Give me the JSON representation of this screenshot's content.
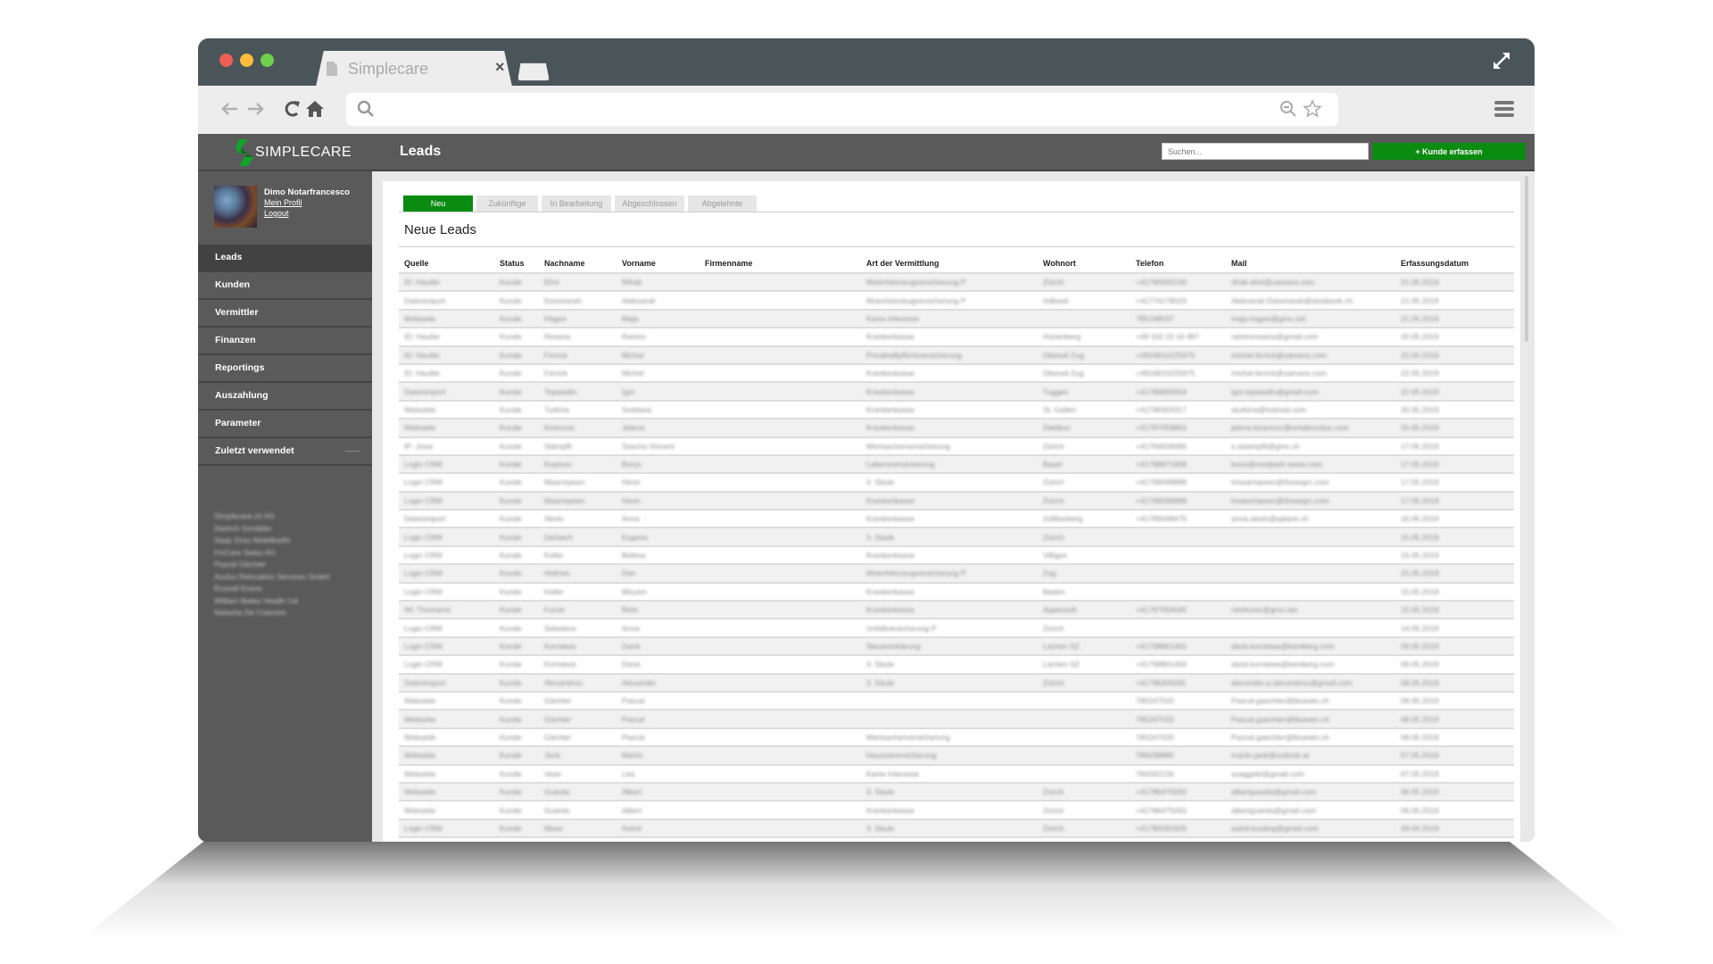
{
  "browser": {
    "tab_title": "Simplecare",
    "tab_close": "×",
    "icons": [
      "back-arrow-icon",
      "forward-arrow-icon",
      "reload-icon",
      "home-icon",
      "search-icon",
      "zoom-out-icon",
      "star-icon",
      "menu-icon",
      "expand-icon",
      "document-icon"
    ]
  },
  "app": {
    "logo_text": "SIMPLECARE",
    "page_title": "Leads",
    "search_placeholder": "Suchen...",
    "add_button": "+  Kunde erfassen",
    "brand_color": "#0b8c10"
  },
  "profile": {
    "name": "Dimo Notarfrancesco",
    "profile_link": "Mein Profil",
    "logout_link": "Logout"
  },
  "sidebar": {
    "items": [
      {
        "label": "Leads",
        "active": true
      },
      {
        "label": "Kunden"
      },
      {
        "label": "Vermittler"
      },
      {
        "label": "Finanzen"
      },
      {
        "label": "Reportings"
      },
      {
        "label": "Auszahlung"
      },
      {
        "label": "Parameter"
      },
      {
        "label": "Zuletzt verwendet",
        "collapsible": true
      }
    ],
    "recent": [
      "Simplecare.ch AG",
      "Dietrich Schöbler",
      "Sepp Zirey Abdelkadhi",
      "FinCare Swiss AG",
      "Pascal Gächter",
      "Avolux Relocation Services GmbH",
      "Russell Evans",
      "William Bailey Health Ltd",
      "Natasha De Coteclos"
    ]
  },
  "main": {
    "tabs": [
      {
        "label": "Neu",
        "active": true
      },
      {
        "label": "Zukünftige"
      },
      {
        "label": "In Bearbeitung"
      },
      {
        "label": "Abgeschlossen"
      },
      {
        "label": "Abgelehnte"
      }
    ],
    "section_title": "Neue Leads",
    "columns": [
      "Quelle",
      "Status",
      "Nachname",
      "Vorname",
      "Firmenname",
      "Art der Vermittlung",
      "Wohnort",
      "Telefon",
      "Mail",
      "Erfassungsdatum"
    ],
    "rows": [
      [
        "ID: Hautlei",
        "Kunde",
        "Elmi",
        "Rihab",
        "",
        "Motorfahrzeugversicherung P",
        "Zürich",
        "+41780000140",
        "rihab.elmi@xamans.com",
        "21.05.2019"
      ],
      [
        "Datenimport",
        "Kunde",
        "Dotomarah",
        "Aleksandr",
        "",
        "Motorfahrzeugversicherung P",
        "Adliswil",
        "+41774178020",
        "Aleksandr.Dotomarah@dastbank.ch",
        "21.05.2019"
      ],
      [
        "Webseite",
        "Kunde",
        "Hagen",
        "Maja",
        "",
        "Keine Interesse",
        "",
        "785198037",
        "maja.hagen@gmx.net",
        "21.05.2019"
      ],
      [
        "ID: Hautlei",
        "Kunde",
        "Resana",
        "Ramiro",
        "",
        "Krankenkasse",
        "Hünenberg",
        "+49 163 23 16 497",
        "ramiroresana@gmail.com",
        "20.05.2019"
      ],
      [
        "ID: Hautlei",
        "Kunde",
        "Ferrick",
        "Michel",
        "",
        "Privathaftpflichtversicherung",
        "Oberwil Zug",
        "+4916810225975",
        "michel.ferrick@xamans.com",
        "22.05.2019"
      ],
      [
        "ID: Hautlei",
        "Kunde",
        "Ferrick",
        "Michel",
        "",
        "Krankenkasse",
        "Oberwil Zug",
        "+4916810225975",
        "michel.ferrick@xamans.com",
        "22.05.2019"
      ],
      [
        "Datenimport",
        "Kunde",
        "Topaladin",
        "Igor",
        "",
        "Krankenkasse",
        "Tuggen",
        "+41786800554",
        "igor.topaladin@gmail.com",
        "22.05.2019"
      ],
      [
        "Webseite",
        "Kunde",
        "Turkina",
        "Svetlana",
        "",
        "Krankenkasse",
        "St. Gallen",
        "+41786303317",
        "sturkina@hotmail.com",
        "20.05.2019"
      ],
      [
        "Webseite",
        "Kunde",
        "Kiranovic",
        "Jelena",
        "",
        "Krankenkasse",
        "Dietikon",
        "+41787059863",
        "jelena.kiranovic@emidexodus.com",
        "20.05.2019"
      ],
      [
        "IP: Jossi",
        "Kunde",
        "Stämpfli",
        "Sascha Vincent",
        "",
        "Wertsachenversicherung",
        "Zürich",
        "+41794634086",
        "s.staempfli@gmx.ch",
        "17.05.2019"
      ],
      [
        "Login CRM",
        "Kunde",
        "Kuptsov",
        "Borys",
        "",
        "Lebensversicherung",
        "Basel",
        "+41788871808",
        "boris@medpark-swiss.com",
        "17.05.2019"
      ],
      [
        "Login CRM",
        "Kunde",
        "Maarmpeen",
        "Henri",
        "",
        "3. Säule",
        "Zürich",
        "+41799008888",
        "hmaarmpeen@thosegrc.com",
        "17.05.2019"
      ],
      [
        "Login CRM",
        "Kunde",
        "Maarmpeen",
        "Henri",
        "",
        "Krankenkasse",
        "Zürich",
        "+41799008888",
        "hmaarmpeen@thosegrc.com",
        "17.05.2019"
      ],
      [
        "Datenimport",
        "Kunde",
        "Abolo",
        "Anna",
        "",
        "Krankenkasse",
        "Zollikerberg",
        "+41789008475",
        "anna.abolo@splank.ch",
        "16.05.2019"
      ],
      [
        "Login CRM",
        "Kunde",
        "Derbach",
        "Eugene",
        "",
        "3. Säule",
        "Zürich",
        "",
        "",
        "15.05.2019"
      ],
      [
        "Login CRM",
        "Kunde",
        "Keller",
        "Bettina",
        "",
        "Krankenkasse",
        "Villigen",
        "",
        "",
        "15.05.2019"
      ],
      [
        "Login CRM",
        "Kunde",
        "Holmes",
        "Dan",
        "",
        "Motorfahrzeugversicherung P",
        "Zug",
        "",
        "",
        "15.05.2019"
      ],
      [
        "Login CRM",
        "Kunde",
        "Keller",
        "Miryam",
        "",
        "Krankenkasse",
        "Baden",
        "",
        "",
        "15.05.2019"
      ],
      [
        "IM: Thomanni",
        "Kunde",
        "Furrer",
        "Reto",
        "",
        "Krankenkasse",
        "Appenzell",
        "+41787054045",
        "retofurrer@gmx.net",
        "15.05.2019"
      ],
      [
        "Login CRM",
        "Kunde",
        "Sebekina",
        "Anna",
        "",
        "Unfallversicherung P",
        "Zürich",
        "",
        "",
        "14.05.2019"
      ],
      [
        "Login CRM",
        "Kunde",
        "Korniewa",
        "Daria",
        "",
        "Steuererklärung",
        "Lachen SZ",
        "+41798801450",
        "daria.korniewa@kantberg.com",
        "09.05.2019"
      ],
      [
        "Login CRM",
        "Kunde",
        "Korniewa",
        "Daria",
        "",
        "3. Säule",
        "Lachen SZ",
        "+41798801450",
        "daria.korniewa@kantberg.com",
        "09.05.2019"
      ],
      [
        "Datenimport",
        "Kunde",
        "Alexandrou",
        "Alexander",
        "",
        "3. Säule",
        "Zürich",
        "+41796305581",
        "alexander.a.alexandrou@gmail.com",
        "08.05.2019"
      ],
      [
        "Webseite",
        "Kunde",
        "Gächter",
        "Pascal",
        "",
        "",
        "",
        "785247533",
        "Pascal.gaechter@bluewin.ch",
        "08.05.2019"
      ],
      [
        "Webseite",
        "Kunde",
        "Gächter",
        "Pascal",
        "",
        "",
        "",
        "785247533",
        "Pascal.gaechter@bluewin.ch",
        "08.05.2019"
      ],
      [
        "Webseite",
        "Kunde",
        "Gächter",
        "Pascal",
        "",
        "Wertsachenversicherung",
        "",
        "785247533",
        "Pascal.gaechter@bluewin.ch",
        "08.05.2019"
      ],
      [
        "Webseite",
        "Kunde",
        "Jank",
        "Martin",
        "",
        "Hausratversicherung",
        "",
        "786038880",
        "martin.jank@outlook.at",
        "07.05.2019"
      ],
      [
        "Webseite",
        "Kunde",
        "Vase",
        "Lea",
        "",
        "Keine Interesse",
        "",
        "784342134",
        "suaggele@gmail.com",
        "07.05.2019"
      ],
      [
        "Webseite",
        "Kunde",
        "Guarda",
        "Albert",
        "",
        "3. Säule",
        "Zürich",
        "+41786475050",
        "albertguarda@gmail.com",
        "06.05.2019"
      ],
      [
        "Webseite",
        "Kunde",
        "Guarda",
        "Albert",
        "",
        "Krankenkasse",
        "Zürich",
        "+41786475050",
        "albertguarda@gmail.com",
        "06.05.2019"
      ],
      [
        "Login CRM",
        "Kunde",
        "Meier",
        "Astrid",
        "",
        "3. Säule",
        "Zürich",
        "+41785581605",
        "astrid.kosting@gmail.com",
        "29.04.2019"
      ]
    ]
  }
}
